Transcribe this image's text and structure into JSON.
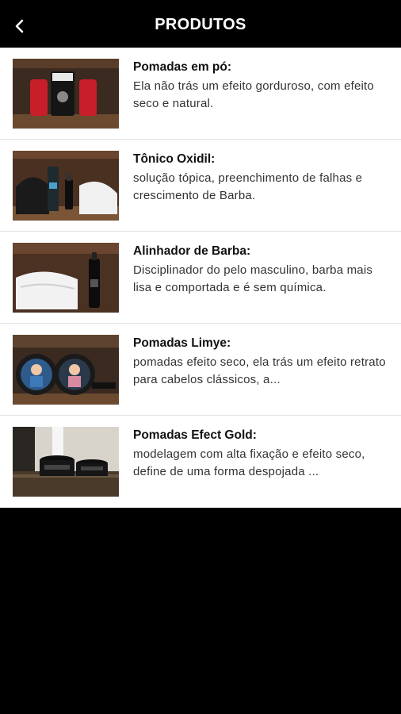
{
  "header": {
    "title": "PRODUTOS",
    "back_icon": "chevron-left-icon"
  },
  "products": [
    {
      "name": "Pomadas em pó:",
      "description": "Ela não trás um efeito gorduroso, com efeito seco e natural."
    },
    {
      "name": "Tônico Oxidil:",
      "description": "solução tópica, preenchimento de falhas e crescimento de Barba."
    },
    {
      "name": "Alinhador de Barba:",
      "description": "Disciplinador do pelo masculino, barba mais lisa e comportada e é sem química."
    },
    {
      "name": "Pomadas Limye:",
      "description": "pomadas efeito seco, ela trás um efeito retrato para cabelos clássicos, a..."
    },
    {
      "name": "Pomadas Efect Gold:",
      "description": "modelagem com alta fixação e efeito seco, define de uma forma despojada ..."
    }
  ]
}
